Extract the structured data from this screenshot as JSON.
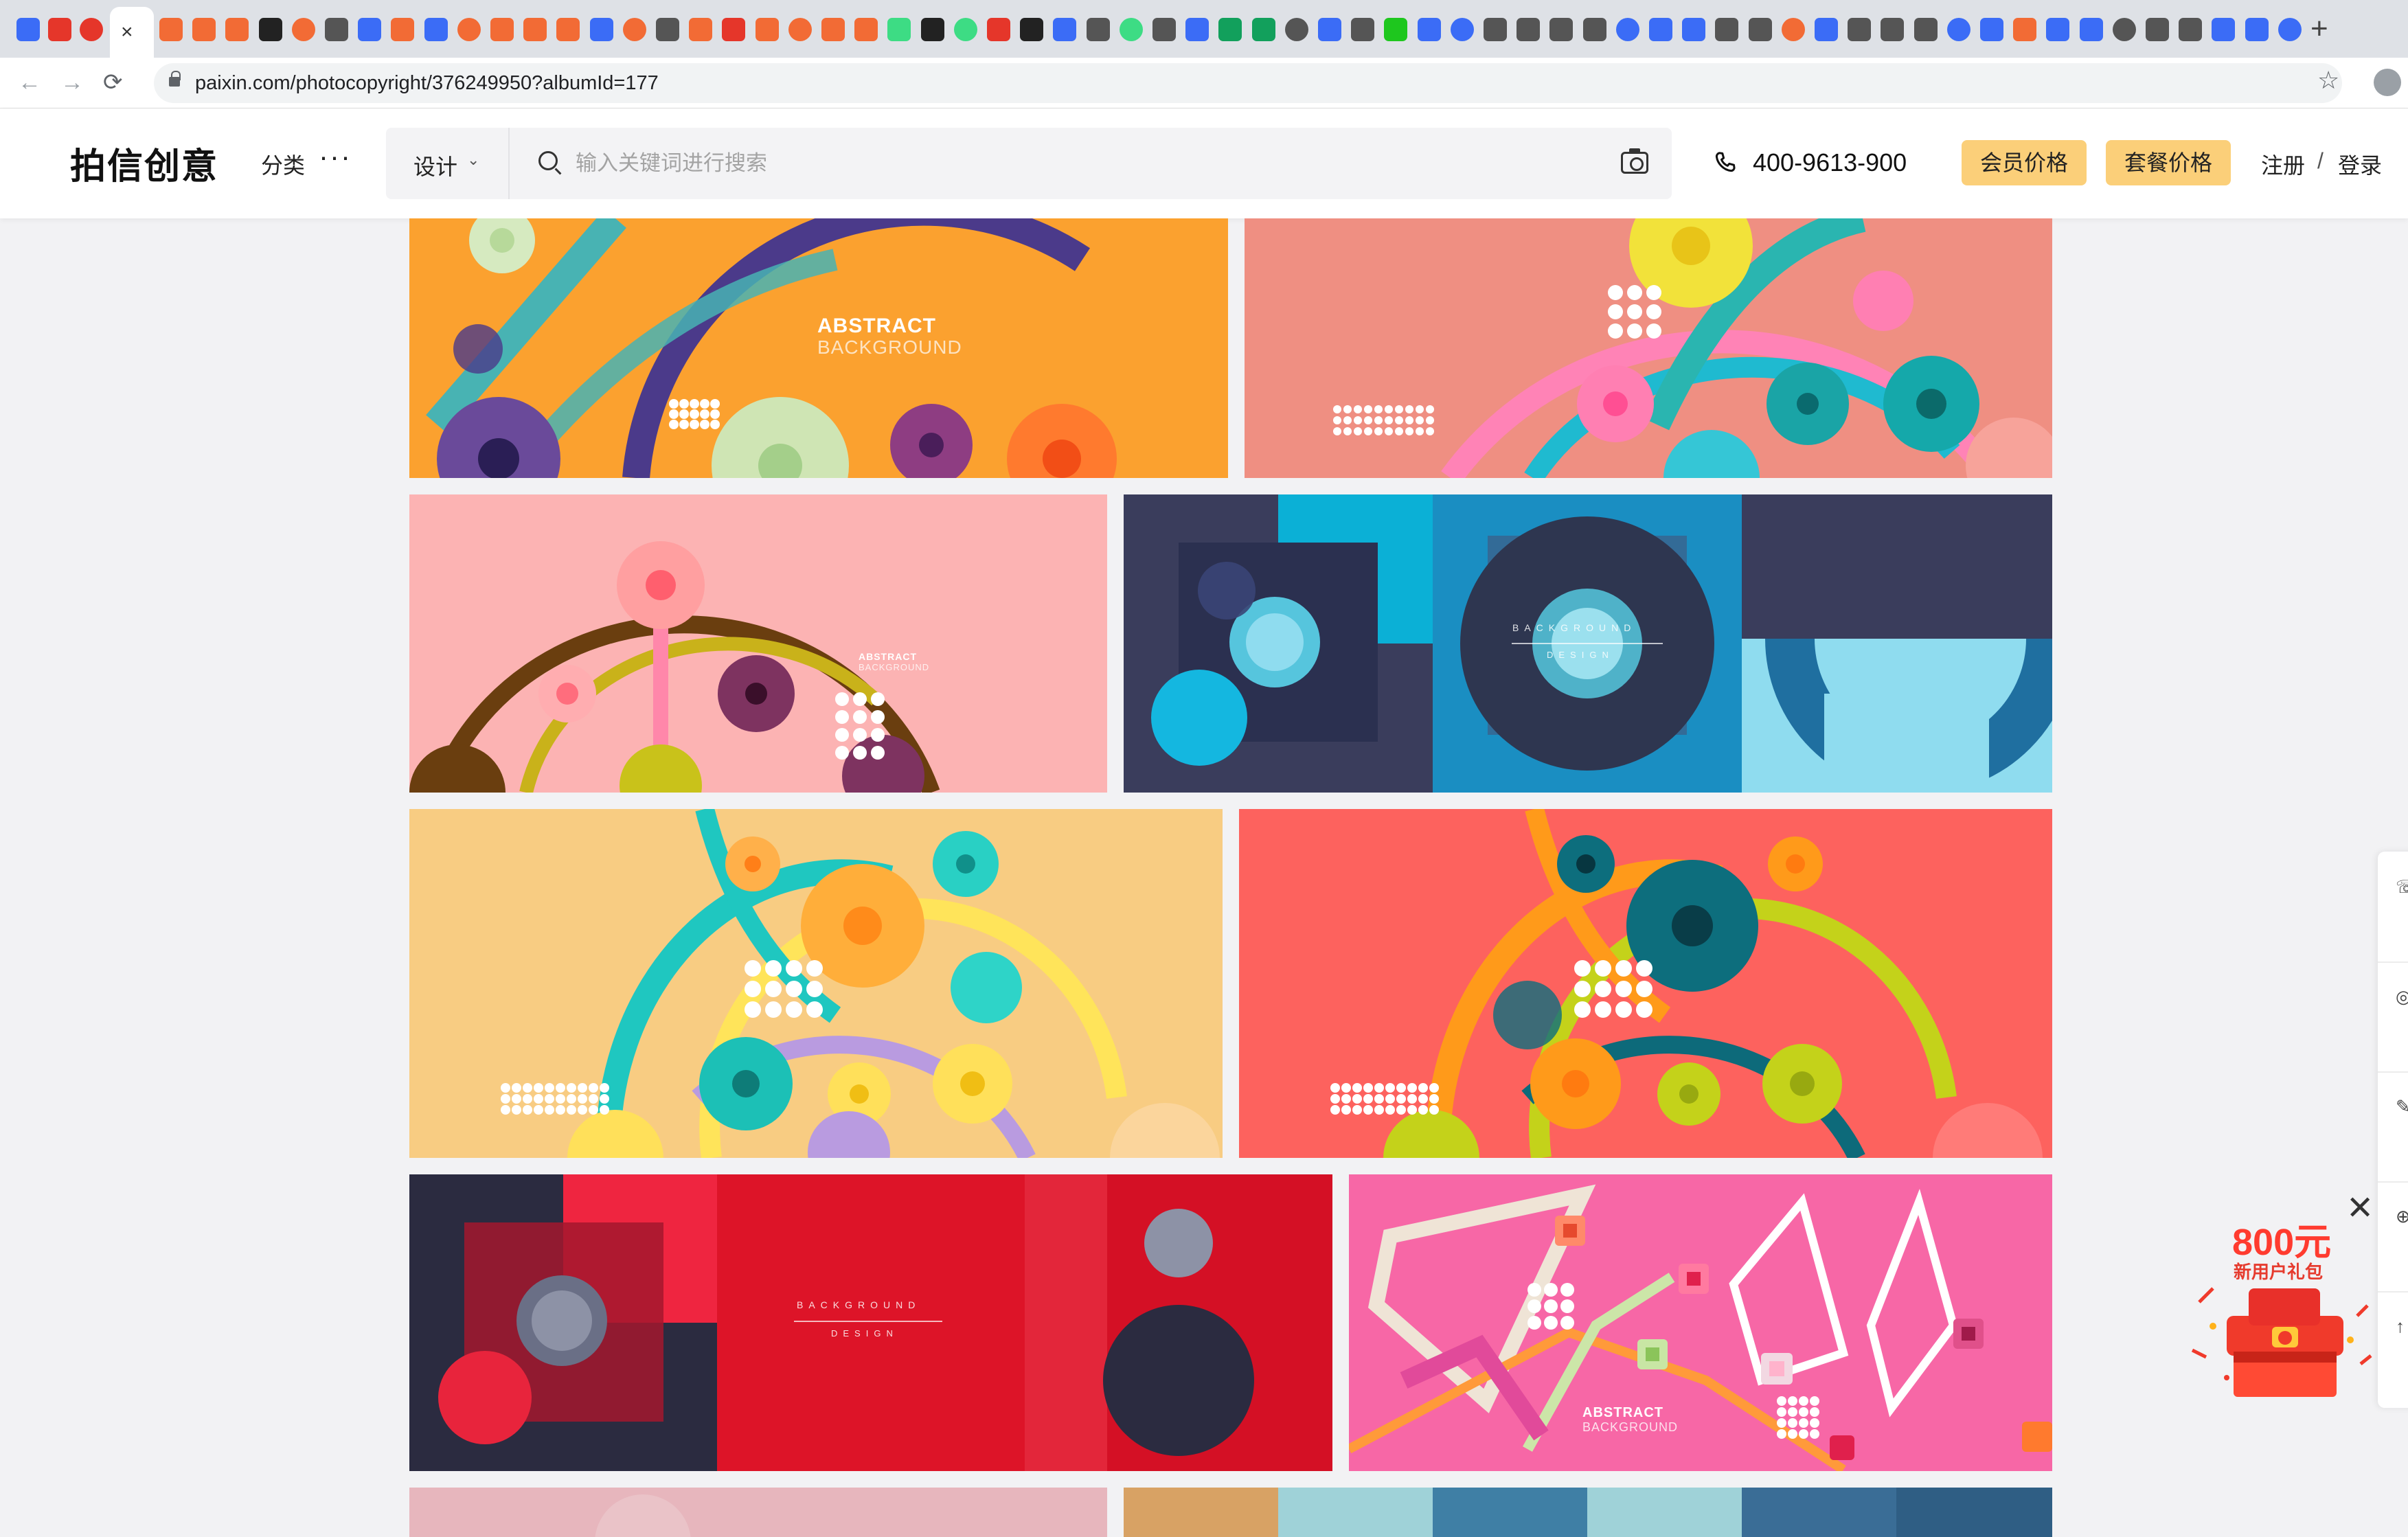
{
  "browser": {
    "active_tab_close": "×",
    "new_tab": "+",
    "url": "paixin.com/photocopyright/376249950?albumId=177",
    "back": "←",
    "forward": "→",
    "reload": "⟳",
    "bookmark": "☆",
    "tab_icons": [
      "#3b6cf6",
      "#e5362a",
      "#e5362a",
      "#f26b35",
      "#f26b35",
      "#f26b35",
      "#222222",
      "#f26b35",
      "#555555",
      "#3b6cf6",
      "#f26b35",
      "#3b6cf6",
      "#f26b35",
      "#f26b35",
      "#f26b35",
      "#f26b35",
      "#3b6cf6",
      "#f26b35",
      "#555555",
      "#f26b35",
      "#e5362a",
      "#f26b35",
      "#f26b35",
      "#f26b35",
      "#f26b35",
      "#3ddc84",
      "#222222",
      "#3ddc84",
      "#e5362a",
      "#222222",
      "#3b6cf6",
      "#555555",
      "#3ddc84",
      "#555555",
      "#3b6cf6",
      "#12a05c",
      "#12a05c",
      "#555555",
      "#3b6cf6",
      "#555555",
      "#1ec71e",
      "#3b6cf6",
      "#3b6cf6",
      "#555555",
      "#555555",
      "#555555",
      "#555555",
      "#3b6cf6",
      "#3b6cf6",
      "#3b6cf6",
      "#555555",
      "#555555",
      "#f26b35",
      "#3b6cf6",
      "#555555",
      "#555555",
      "#555555",
      "#3b6cf6",
      "#3b6cf6",
      "#f26b35",
      "#3b6cf6",
      "#3b6cf6",
      "#555555",
      "#555555",
      "#555555",
      "#3b6cf6",
      "#3b6cf6",
      "#3b6cf6"
    ]
  },
  "header": {
    "logo": "拍信创意",
    "category": "分类",
    "more": "···",
    "search_type": "设计",
    "search_placeholder": "输入关键词进行搜索",
    "phone": "400-9613-900",
    "member_price": "会员价格",
    "package_price": "套餐价格",
    "register": "注册",
    "divider": "/",
    "login": "登录"
  },
  "gallery": {
    "tiles": [
      {
        "caption_1": "ABSTRACT",
        "caption_2": "BACKGROUND"
      },
      {
        "caption_1": "",
        "caption_2": ""
      },
      {
        "caption_1": "ABSTRACT",
        "caption_2": "BACKGROUND"
      },
      {
        "caption_1": "BACKGROUND",
        "caption_2": "DESIGN"
      },
      {
        "caption_1": "",
        "caption_2": ""
      },
      {
        "caption_1": "",
        "caption_2": ""
      },
      {
        "caption_1": "BACKGROUND",
        "caption_2": "DESIGN"
      },
      {
        "caption_1": "ABSTRACT",
        "caption_2": "BACKGROUND"
      }
    ]
  },
  "promo": {
    "close": "✕",
    "amount": "800元",
    "subtitle": "新用户礼包",
    "colors": {
      "accent": "#ff3b2f",
      "gift": "#f03a2b"
    }
  },
  "colors": {
    "brand_pill": "#fbcf79",
    "page_bg": "#f2f2f4"
  }
}
